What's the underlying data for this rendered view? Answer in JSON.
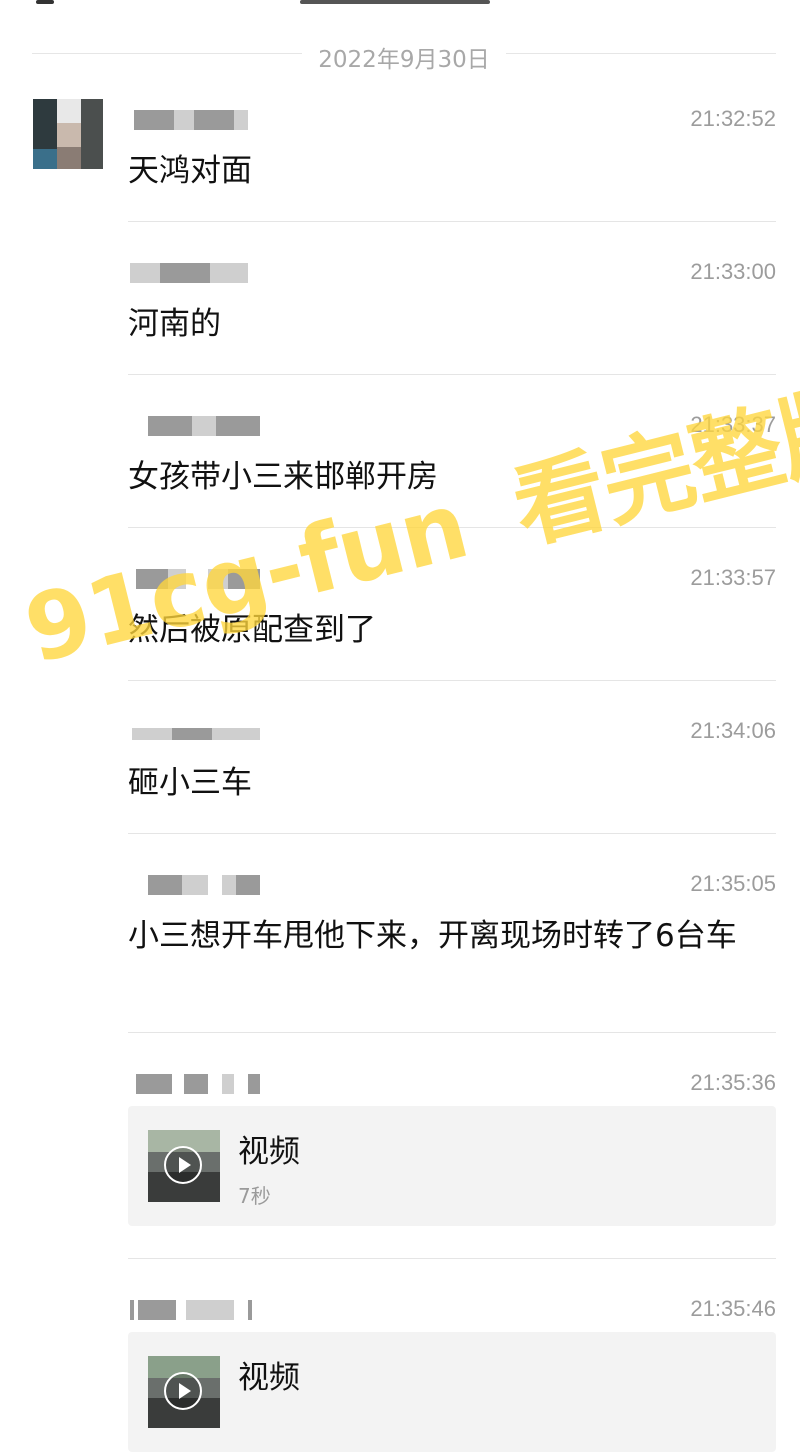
{
  "chat": {
    "date_divider": "2022年9月30日",
    "messages": [
      {
        "time": "21:32:52",
        "text": "天鸿对面"
      },
      {
        "time": "21:33:00",
        "text": "河南的"
      },
      {
        "time": "21:33:37",
        "text": "女孩带小三来邯郸开房"
      },
      {
        "time": "21:33:57",
        "text": "然后被原配查到了"
      },
      {
        "time": "21:34:06",
        "text": "砸小三车"
      },
      {
        "time": "21:35:05",
        "text": "小三想开车甩他下来，开离现场时转了6台车"
      },
      {
        "time": "21:35:36",
        "video": {
          "title": "视频",
          "duration": "7秒"
        }
      },
      {
        "time": "21:35:46",
        "video": {
          "title": "视频",
          "duration": ""
        }
      }
    ]
  },
  "watermark": {
    "text_latin": "91cg-fun",
    "text_cjk": "看完整版"
  },
  "colors": {
    "watermark": "#ffd63c",
    "time": "#9c9c9c",
    "separator": "#e5e5e5"
  },
  "icons": {
    "video_play": "play-icon"
  }
}
